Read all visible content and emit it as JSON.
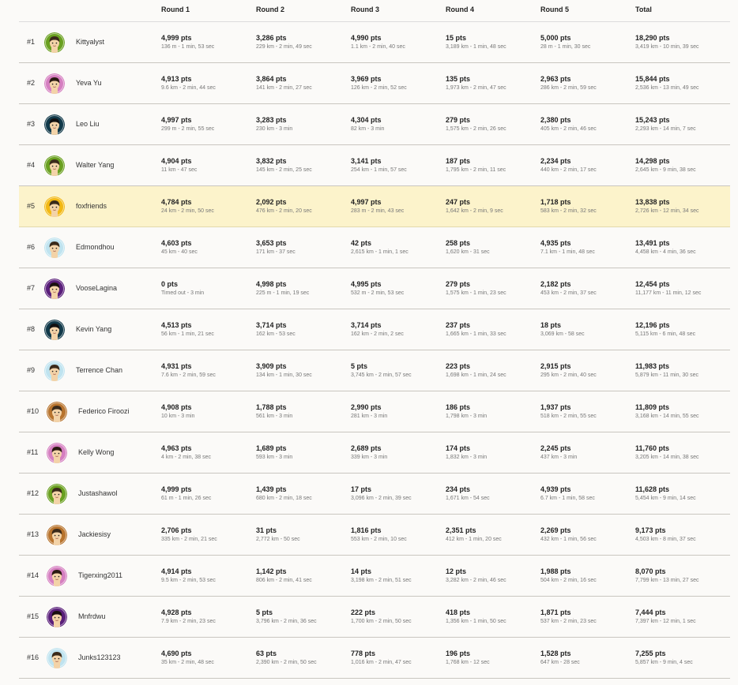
{
  "headers": [
    "Round 1",
    "Round 2",
    "Round 3",
    "Round 4",
    "Round 5",
    "Total"
  ],
  "rows": [
    {
      "rank": "#1",
      "name": "Kittyalyst",
      "avatar": {
        "bg": "#6aa020",
        "hair": "#3a2a1a",
        "skin": "#f3d3a8"
      },
      "rounds": [
        [
          "4,999 pts",
          "136 m - 1 min, 53 sec"
        ],
        [
          "3,286 pts",
          "229 km - 2 min, 49 sec"
        ],
        [
          "4,990 pts",
          "1.1 km - 2 min, 40 sec"
        ],
        [
          "15 pts",
          "3,189 km - 1 min, 48 sec"
        ],
        [
          "5,000 pts",
          "28 m - 1 min, 30 sec"
        ],
        [
          "18,290 pts",
          "3,419 km - 10 min, 39 sec"
        ]
      ]
    },
    {
      "rank": "#2",
      "name": "Yeva Yu",
      "avatar": {
        "bg": "#d57fc0",
        "hair": "#2a1a12",
        "skin": "#f3d3a8"
      },
      "rounds": [
        [
          "4,913 pts",
          "9.6 km - 2 min, 44 sec"
        ],
        [
          "3,864 pts",
          "141 km - 2 min, 27 sec"
        ],
        [
          "3,969 pts",
          "126 km - 2 min, 52 sec"
        ],
        [
          "135 pts",
          "1,973 km - 2 min, 47 sec"
        ],
        [
          "2,963 pts",
          "286 km - 2 min, 59 sec"
        ],
        [
          "15,844 pts",
          "2,536 km - 13 min, 49 sec"
        ]
      ]
    },
    {
      "rank": "#3",
      "name": "Leo Liu",
      "avatar": {
        "bg": "#123a4a",
        "hair": "#111111",
        "skin": "#f3d3a8"
      },
      "rounds": [
        [
          "4,997 pts",
          "299 m - 2 min, 55 sec"
        ],
        [
          "3,283 pts",
          "230 km - 3 min"
        ],
        [
          "4,304 pts",
          "82 km - 3 min"
        ],
        [
          "279 pts",
          "1,575 km - 2 min, 26 sec"
        ],
        [
          "2,380 pts",
          "405 km - 2 min, 46 sec"
        ],
        [
          "15,243 pts",
          "2,293 km - 14 min, 7 sec"
        ]
      ]
    },
    {
      "rank": "#4",
      "name": "Walter Yang",
      "avatar": {
        "bg": "#6aa020",
        "hair": "#3a2a1a",
        "skin": "#f3d3a8"
      },
      "rounds": [
        [
          "4,904 pts",
          "11 km - 47 sec"
        ],
        [
          "3,832 pts",
          "145 km - 2 min, 25 sec"
        ],
        [
          "3,141 pts",
          "254 km - 1 min, 57 sec"
        ],
        [
          "187 pts",
          "1,795 km - 2 min, 11 sec"
        ],
        [
          "2,234 pts",
          "440 km - 2 min, 17 sec"
        ],
        [
          "14,298 pts",
          "2,645 km - 9 min, 38 sec"
        ]
      ]
    },
    {
      "rank": "#5",
      "name": "foxfriends",
      "avatar": {
        "bg": "#f2b814",
        "hair": "#3a2a1a",
        "skin": "#f3d3a8"
      },
      "highlight": true,
      "rounds": [
        [
          "4,784 pts",
          "24 km - 2 min, 50 sec"
        ],
        [
          "2,092 pts",
          "476 km - 2 min, 20 sec"
        ],
        [
          "4,997 pts",
          "283 m - 2 min, 43 sec"
        ],
        [
          "247 pts",
          "1,642 km - 2 min, 9 sec"
        ],
        [
          "1,718 pts",
          "583 km - 2 min, 32 sec"
        ],
        [
          "13,838 pts",
          "2,726 km - 12 min, 34 sec"
        ]
      ]
    },
    {
      "rank": "#6",
      "name": "Edmondhou",
      "avatar": {
        "bg": "#bfe3ef",
        "hair": "#3a2a1a",
        "skin": "#f3d3a8"
      },
      "rounds": [
        [
          "4,603 pts",
          "45 km - 40 sec"
        ],
        [
          "3,653 pts",
          "171 km - 37 sec"
        ],
        [
          "42 pts",
          "2,615 km - 1 min, 1 sec"
        ],
        [
          "258 pts",
          "1,620 km - 31 sec"
        ],
        [
          "4,935 pts",
          "7.1 km - 1 min, 48 sec"
        ],
        [
          "13,491 pts",
          "4,458 km - 4 min, 36 sec"
        ]
      ]
    },
    {
      "rank": "#7",
      "name": "VooseLagina",
      "avatar": {
        "bg": "#5a1f7a",
        "hair": "#1a1010",
        "skin": "#f3d3a8"
      },
      "rounds": [
        [
          "0 pts",
          "Timed out - 3 min"
        ],
        [
          "4,998 pts",
          "225 m - 1 min, 19 sec"
        ],
        [
          "4,995 pts",
          "532 m - 2 min, 53 sec"
        ],
        [
          "279 pts",
          "1,575 km - 1 min, 23 sec"
        ],
        [
          "2,182 pts",
          "453 km - 2 min, 37 sec"
        ],
        [
          "12,454 pts",
          "11,177 km - 11 min, 12 sec"
        ]
      ]
    },
    {
      "rank": "#8",
      "name": "Kevin Yang",
      "avatar": {
        "bg": "#123a4a",
        "hair": "#111111",
        "skin": "#f3d3a8"
      },
      "rounds": [
        [
          "4,513 pts",
          "56 km - 1 min, 21 sec"
        ],
        [
          "3,714 pts",
          "162 km - 53 sec"
        ],
        [
          "3,714 pts",
          "162 km - 2 min, 2 sec"
        ],
        [
          "237 pts",
          "1,665 km - 1 min, 33 sec"
        ],
        [
          "18 pts",
          "3,069 km - 58 sec"
        ],
        [
          "12,196 pts",
          "5,115 km - 6 min, 48 sec"
        ]
      ]
    },
    {
      "rank": "#9",
      "name": "Terrence Chan",
      "avatar": {
        "bg": "#bfe3ef",
        "hair": "#3a2a1a",
        "skin": "#f3d3a8"
      },
      "rounds": [
        [
          "4,931 pts",
          "7.6 km - 2 min, 59 sec"
        ],
        [
          "3,909 pts",
          "134 km - 1 min, 30 sec"
        ],
        [
          "5 pts",
          "3,745 km - 2 min, 57 sec"
        ],
        [
          "223 pts",
          "1,698 km - 1 min, 24 sec"
        ],
        [
          "2,915 pts",
          "295 km - 2 min, 40 sec"
        ],
        [
          "11,983 pts",
          "5,879 km - 11 min, 30 sec"
        ]
      ]
    },
    {
      "rank": "#10",
      "name": "Federico Firoozi",
      "avatar": {
        "bg": "#b8742e",
        "hair": "#3a2a1a",
        "skin": "#f3d3a8"
      },
      "rounds": [
        [
          "4,908 pts",
          "10 km - 3 min"
        ],
        [
          "1,788 pts",
          "561 km - 3 min"
        ],
        [
          "2,990 pts",
          "281 km - 3 min"
        ],
        [
          "186 pts",
          "1,798 km - 3 min"
        ],
        [
          "1,937 pts",
          "518 km - 2 min, 55 sec"
        ],
        [
          "11,809 pts",
          "3,168 km - 14 min, 55 sec"
        ]
      ]
    },
    {
      "rank": "#11",
      "name": "Kelly Wong",
      "avatar": {
        "bg": "#d57fc0",
        "hair": "#2a1a12",
        "skin": "#f3d3a8"
      },
      "rounds": [
        [
          "4,963 pts",
          "4 km - 2 min, 38 sec"
        ],
        [
          "1,689 pts",
          "593 km - 3 min"
        ],
        [
          "2,689 pts",
          "339 km - 3 min"
        ],
        [
          "174 pts",
          "1,832 km - 3 min"
        ],
        [
          "2,245 pts",
          "437 km - 3 min"
        ],
        [
          "11,760 pts",
          "3,205 km - 14 min, 38 sec"
        ]
      ]
    },
    {
      "rank": "#12",
      "name": "Justashawol",
      "avatar": {
        "bg": "#6aa020",
        "hair": "#3a2a1a",
        "skin": "#f3d3a8"
      },
      "rounds": [
        [
          "4,999 pts",
          "61 m - 1 min, 26 sec"
        ],
        [
          "1,439 pts",
          "680 km - 2 min, 18 sec"
        ],
        [
          "17 pts",
          "3,096 km - 2 min, 39 sec"
        ],
        [
          "234 pts",
          "1,671 km - 54 sec"
        ],
        [
          "4,939 pts",
          "6.7 km - 1 min, 58 sec"
        ],
        [
          "11,628 pts",
          "5,454 km - 9 min, 14 sec"
        ]
      ]
    },
    {
      "rank": "#13",
      "name": "Jackiesisy",
      "avatar": {
        "bg": "#b8742e",
        "hair": "#3a2a1a",
        "skin": "#f3d3a8"
      },
      "rounds": [
        [
          "2,706 pts",
          "335 km - 2 min, 21 sec"
        ],
        [
          "31 pts",
          "2,772 km - 50 sec"
        ],
        [
          "1,816 pts",
          "553 km - 2 min, 10 sec"
        ],
        [
          "2,351 pts",
          "412 km - 1 min, 20 sec"
        ],
        [
          "2,269 pts",
          "432 km - 1 min, 56 sec"
        ],
        [
          "9,173 pts",
          "4,503 km - 8 min, 37 sec"
        ]
      ]
    },
    {
      "rank": "#14",
      "name": "Tigerxing2011",
      "avatar": {
        "bg": "#d57fc0",
        "hair": "#2a1a12",
        "skin": "#f3d3a8"
      },
      "rounds": [
        [
          "4,914 pts",
          "9.5 km - 2 min, 53 sec"
        ],
        [
          "1,142 pts",
          "806 km - 2 min, 41 sec"
        ],
        [
          "14 pts",
          "3,198 km - 2 min, 51 sec"
        ],
        [
          "12 pts",
          "3,282 km - 2 min, 46 sec"
        ],
        [
          "1,988 pts",
          "504 km - 2 min, 16 sec"
        ],
        [
          "8,070 pts",
          "7,799 km - 13 min, 27 sec"
        ]
      ]
    },
    {
      "rank": "#15",
      "name": "Mnfrdwu",
      "avatar": {
        "bg": "#5a1f7a",
        "hair": "#1a1010",
        "skin": "#f3d3a8"
      },
      "rounds": [
        [
          "4,928 pts",
          "7.9 km - 2 min, 23 sec"
        ],
        [
          "5 pts",
          "3,796 km - 2 min, 36 sec"
        ],
        [
          "222 pts",
          "1,700 km - 2 min, 50 sec"
        ],
        [
          "418 pts",
          "1,356 km - 1 min, 50 sec"
        ],
        [
          "1,871 pts",
          "537 km - 2 min, 23 sec"
        ],
        [
          "7,444 pts",
          "7,397 km - 12 min, 1 sec"
        ]
      ]
    },
    {
      "rank": "#16",
      "name": "Junks123123",
      "avatar": {
        "bg": "#bfe3ef",
        "hair": "#3a2a1a",
        "skin": "#f3d3a8"
      },
      "rounds": [
        [
          "4,690 pts",
          "35 km - 2 min, 48 sec"
        ],
        [
          "63 pts",
          "2,390 km - 2 min, 50 sec"
        ],
        [
          "778 pts",
          "1,016 km - 2 min, 47 sec"
        ],
        [
          "196 pts",
          "1,768 km - 12 sec"
        ],
        [
          "1,528 pts",
          "647 km - 28 sec"
        ],
        [
          "7,255 pts",
          "5,857 km - 9 min, 4 sec"
        ]
      ]
    }
  ]
}
